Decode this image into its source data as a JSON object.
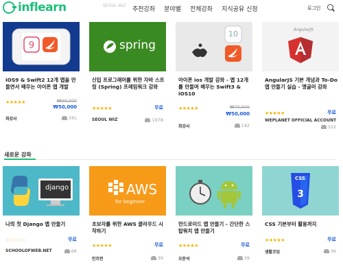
{
  "header": {
    "logo_text": "inflearn",
    "nav": [
      "추천강좌",
      "분야별",
      "전체강좌",
      "지식공유 신청"
    ],
    "login": "로그인",
    "ghost_text": "SEOUL WIZ"
  },
  "courses_top": [
    {
      "title": "iOS9 & Swift2 12개 앱을 만들면서 배우는 아이폰 앱 개발",
      "rating_stars": "★★★★★",
      "old_price": "₩90,000",
      "price": "₩50,000",
      "author": "최강사",
      "students": "341"
    },
    {
      "title": "신입 프로그래머를 위한 자바 스프링 (Spring) 프레임워크 강좌",
      "rating_stars": "★★★★★",
      "old_price": "",
      "price": "무료",
      "author": "SEOUL WIZ",
      "students": "1978",
      "thumb_text": "spring"
    },
    {
      "title": "아이폰 ios 개발 강좌 - 앱 12개를 만들며 배우는 Swift3 & iOS10",
      "rating_stars": "★★★★★",
      "old_price": "₩70,000",
      "price": "₩50,000",
      "author": "최강사",
      "students": "142",
      "thumb_text": "10"
    },
    {
      "title": "AngularJS 기본 개념과 To-Do 앱 만들기 실습 - 앵귤러 강좌",
      "rating_stars": "★★★★★",
      "old_price": "",
      "price": "무료",
      "author": "WEPLANET OFFICIAL ACCOUNT",
      "students": "322",
      "thumb_text": "AngularJS"
    }
  ],
  "section": {
    "title": "새로운 강좌"
  },
  "courses_new": [
    {
      "title": "나의 첫 Django 앱 만들기",
      "rating_stars": "☆☆☆☆☆",
      "price": "무료",
      "author": "SCHOOLOFWEB.NET",
      "students": "66",
      "thumb_text": "django"
    },
    {
      "title": "초보자를 위한 AWS 클라우드 시작하기",
      "rating_stars": "★★★★★",
      "price": "무료",
      "author": "인프런",
      "students": "39",
      "thumb_text": "AWS",
      "thumb_sub": "for beginner"
    },
    {
      "title": "안드로이드 앱 만들기 - 간단한 스탑워치 앱 만들기",
      "rating_stars": "★★★★★",
      "price": "무료",
      "author": "오준석",
      "students": "39"
    },
    {
      "title": "CSS 기본부터 활용까지",
      "rating_stars": "★★★★★",
      "price": "무료",
      "author": "생활코딩",
      "students": "36",
      "thumb_text": "CSS"
    }
  ],
  "colors": {
    "brand": "#1dc078",
    "price": "#1b5bd6",
    "star": "#f5b300"
  }
}
